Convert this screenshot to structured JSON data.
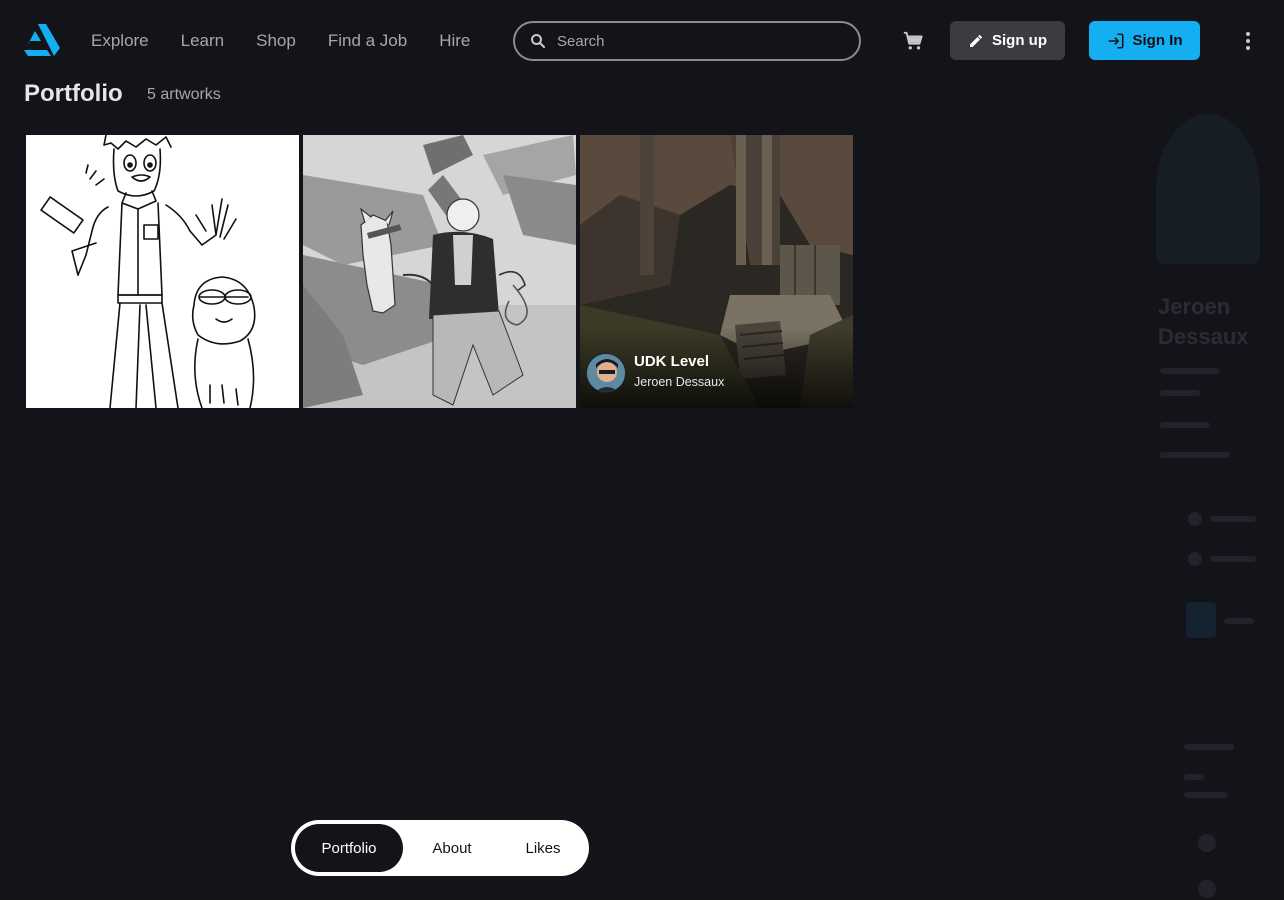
{
  "header": {
    "logo_icon": "artstation-logo-icon",
    "nav": [
      "Explore",
      "Learn",
      "Shop",
      "Find a Job",
      "Hire"
    ],
    "search_placeholder": "Search",
    "cart_icon": "cart-icon",
    "signup_label": "Sign up",
    "signin_label": "Sign In",
    "accent_color": "#13aff0"
  },
  "portfolio": {
    "title": "Portfolio",
    "count": "5 artworks",
    "artworks": [
      {
        "kind": "line-drawing"
      },
      {
        "kind": "grayscale-illustration"
      },
      {
        "title": "UDK Level",
        "author": "Jeroen Dessaux"
      }
    ]
  },
  "tabs": {
    "portfolio": "Portfolio",
    "about": "About",
    "likes": "Likes"
  }
}
